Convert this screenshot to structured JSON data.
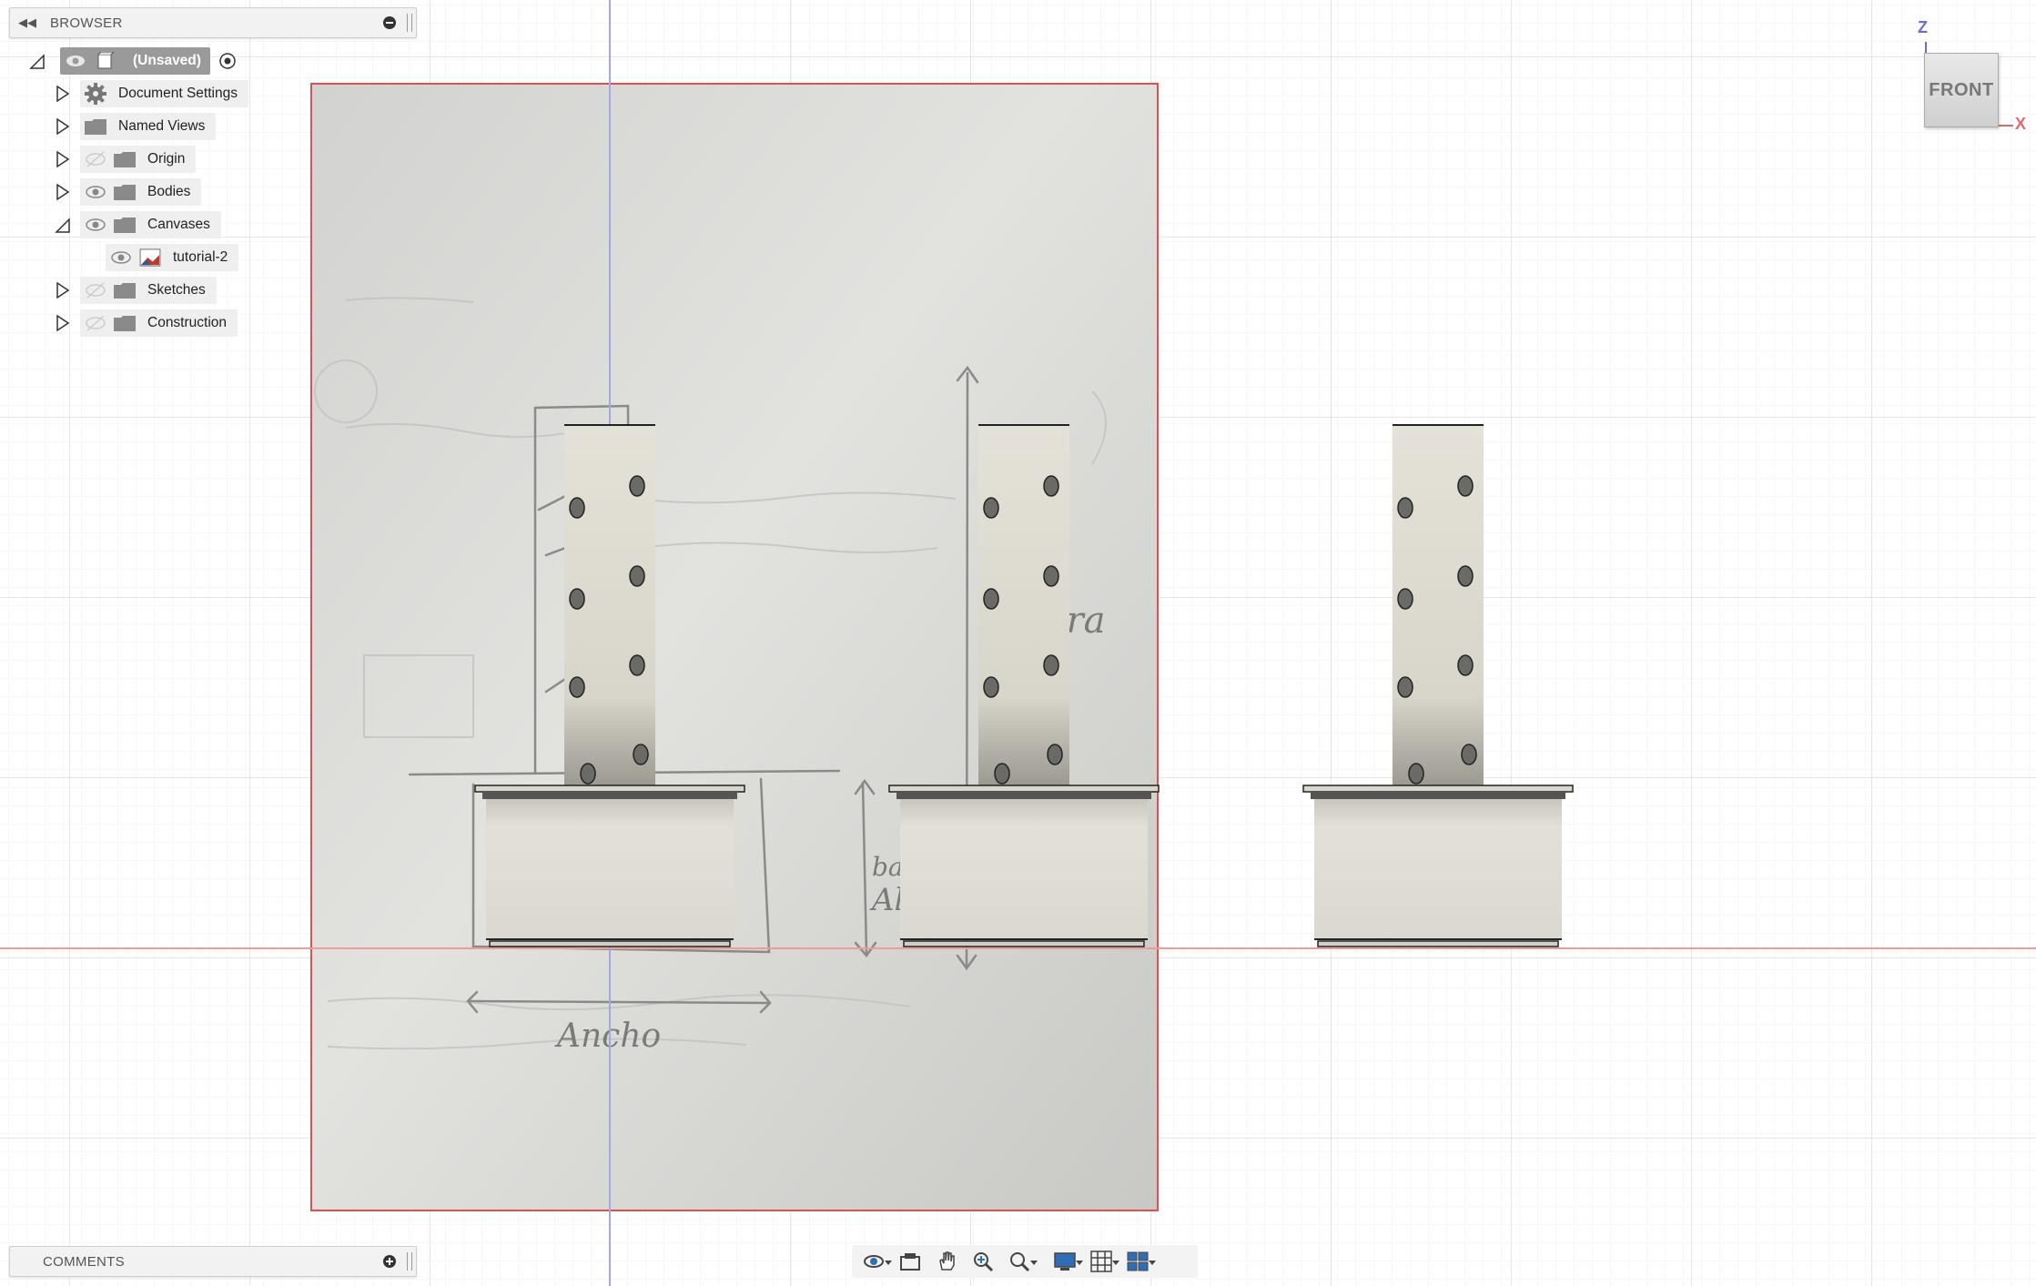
{
  "browser": {
    "title": "BROWSER",
    "root_label": "(Unsaved)",
    "items": [
      {
        "label": "Document Settings",
        "icon": "gear-icon",
        "visibility": "none"
      },
      {
        "label": "Named Views",
        "icon": "folder-icon",
        "visibility": "none"
      },
      {
        "label": "Origin",
        "icon": "folder-icon",
        "visibility": "hidden"
      },
      {
        "label": "Bodies",
        "icon": "folder-icon",
        "visibility": "visible"
      },
      {
        "label": "Canvases",
        "icon": "folder-icon",
        "visibility": "visible",
        "expanded": true
      },
      {
        "label": "tutorial-2",
        "icon": "canvas-image-icon",
        "visibility": "visible"
      },
      {
        "label": "Sketches",
        "icon": "folder-icon",
        "visibility": "hidden"
      },
      {
        "label": "Construction",
        "icon": "folder-icon",
        "visibility": "hidden"
      }
    ]
  },
  "comments": {
    "title": "COMMENTS"
  },
  "view_cube": {
    "face_label": "FRONT",
    "axis_z": "Z",
    "axis_x": "X"
  },
  "canvas_annotations": {
    "height_label": "Altura",
    "base_label": "base",
    "base_ratio_label": "Alt/3",
    "width_label": "Ancho"
  },
  "toolbar": {
    "tools": [
      "orbit-icon",
      "look-at-icon",
      "pan-icon",
      "zoom-icon",
      "fit-icon",
      "display-settings-icon",
      "grid-icon",
      "viewports-icon"
    ]
  },
  "colors": {
    "grid_major": "#d9d9d9",
    "grid_minor": "#ececec",
    "x_axis": "#f0a0a0",
    "z_axis": "#9a9ae0",
    "canvas_border": "#e05050",
    "body_fill": "#dcdad0"
  }
}
